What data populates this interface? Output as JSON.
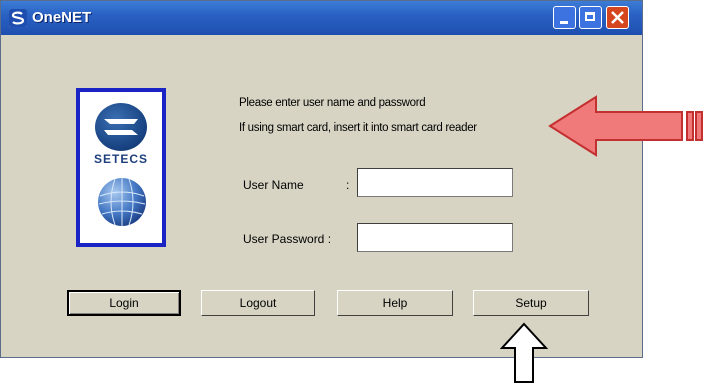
{
  "window": {
    "title": "OneNET",
    "logo_text": "SETECS"
  },
  "message": {
    "line1": "Please enter user name and password",
    "line2": "If using smart card, insert it into smart card reader"
  },
  "form": {
    "username_label": "User Name",
    "username_colon": ":",
    "username_value": "",
    "password_label": "User Password  :",
    "password_value": ""
  },
  "buttons": {
    "login": "Login",
    "logout": "Logout",
    "help": "Help",
    "setup": "Setup"
  },
  "annotations": {
    "arrow_color": "#f07a7a",
    "pointer_arrow_icon": "arrow-up-outline-icon"
  },
  "colors": {
    "titlebar": "#2a62c4",
    "window_bg": "#d8d4c4",
    "logo_border": "#1a23c4",
    "close_button": "#d6461e"
  }
}
